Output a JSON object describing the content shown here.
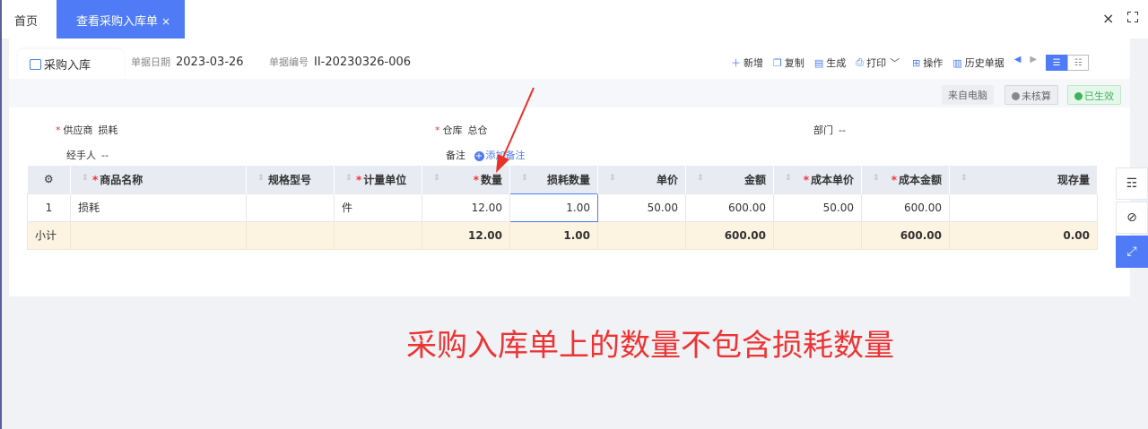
{
  "tabs": {
    "home_label": "首页",
    "active_label": "查看采购入库单",
    "active_close": "×"
  },
  "window": {
    "close_glyph": "×"
  },
  "doc": {
    "tab_label": "采购入库",
    "date_label": "单据日期",
    "date_value": "2023-03-26",
    "no_label": "单据编号",
    "no_value": "II-20230326-006"
  },
  "toolbar": {
    "new_label": "新增",
    "copy_label": "复制",
    "generate_label": "生成",
    "print_label": "打印",
    "operate_label": "操作",
    "history_label": "历史单据"
  },
  "status": {
    "source_label": "来自电脑",
    "review_label": "未核算",
    "effective_label": "已生效"
  },
  "fields": {
    "supplier_label": "供应商",
    "supplier_value": "损耗",
    "warehouse_label": "仓库",
    "warehouse_value": "总仓",
    "dept_label": "部门",
    "dept_value": "--",
    "handler_label": "经手人",
    "handler_value": "--",
    "remark_label": "备注",
    "add_remark": "添加备注"
  },
  "grid": {
    "headers": {
      "name": "商品名称",
      "spec": "规格型号",
      "unit": "计量单位",
      "qty": "数量",
      "loss_qty": "损耗数量",
      "price": "单价",
      "amount": "金额",
      "cost_price": "成本单价",
      "cost_amount": "成本金额",
      "stock": "现存量"
    },
    "rows": [
      {
        "no": "1",
        "name": "损耗",
        "spec": "",
        "unit": "件",
        "qty": "12.00",
        "loss_qty": "1.00",
        "price": "50.00",
        "amount": "600.00",
        "cost_price": "50.00",
        "cost_amount": "600.00",
        "stock": ""
      }
    ],
    "subtotal": {
      "label": "小计",
      "qty": "12.00",
      "loss_qty": "1.00",
      "amount": "600.00",
      "cost_amount": "600.00",
      "stock": "0.00"
    }
  },
  "annotation": {
    "text": "采购入库单上的数量不包含损耗数量",
    "color": "#e8332a"
  },
  "colors": {
    "accent": "#4f7cf6",
    "required": "#e33333",
    "success": "#3bb55d",
    "subtotal_bg": "#fcf3e1"
  }
}
